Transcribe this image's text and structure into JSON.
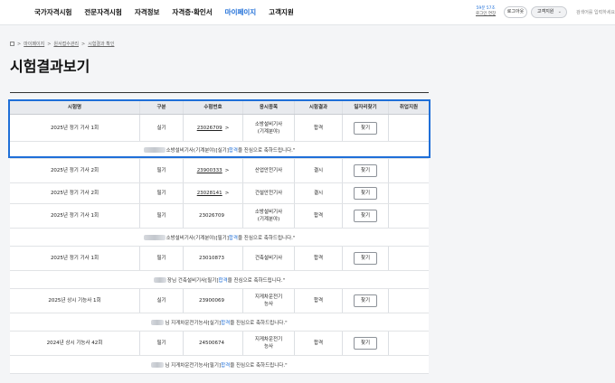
{
  "header": {
    "menu": [
      "국가자격시험",
      "전문자격시험",
      "자격정보",
      "자격증·확인서",
      "마이페이지",
      "고객지원"
    ],
    "active_index": 4,
    "remaining_time": "59분 57초",
    "extend_label": "로그인 연장",
    "logout_label": "로그아웃",
    "cs_label": "고객지원",
    "search_placeholder": "검색어를 입력하세요"
  },
  "breadcrumb": [
    "마이페이지",
    "원서접수관리",
    "시험결과 확인"
  ],
  "page_title": "시험결과보기",
  "table": {
    "headers": [
      "시험명",
      "구분",
      "수험번호",
      "응시종목",
      "시험결과",
      "일자리찾기",
      "취업지원"
    ],
    "rows": [
      {
        "exam": "2025년 정기 기사 1회",
        "type": "실기",
        "number": "23026709",
        "arrow": ">",
        "subject": [
          "소방설비기사",
          "(기계분야)"
        ],
        "result": "합격",
        "find": "찾기",
        "linked": true,
        "message": {
          "pre": "소방설비기사(기계분야)[실기] ",
          "pass": "합격",
          "post": "을 진심으로 축하드립니다.\""
        }
      },
      {
        "exam": "2025년 정기 기사 2회",
        "type": "필기",
        "number": "23900333",
        "arrow": ">",
        "subject": [
          "산업안전기사"
        ],
        "result": "결시",
        "find": "찾기",
        "linked": true
      },
      {
        "exam": "2025년 정기 기사 2회",
        "type": "필기",
        "number": "23028141",
        "arrow": ">",
        "subject": [
          "건설안전기사"
        ],
        "result": "결시",
        "find": "찾기",
        "linked": true
      },
      {
        "exam": "2025년 정기 기사 1회",
        "type": "필기",
        "number": "23026709",
        "arrow": "",
        "subject": [
          "소방설비기사",
          "(기계분야)"
        ],
        "result": "합격",
        "find": "찾기",
        "linked": false,
        "message": {
          "pre": "소방설비기사(기계분야)[필기] ",
          "pass": "합격",
          "post": "을 진심으로 축하드립니다.\""
        }
      },
      {
        "exam": "2025년 정기 기사 1회",
        "type": "필기",
        "number": "23010873",
        "arrow": "",
        "subject": [
          "건축설비기사"
        ],
        "result": "합격",
        "find": "찾기",
        "linked": false,
        "message": {
          "pre": "장님 건축설비기사[필기] ",
          "pass": "합격",
          "post": "을 진심으로 축하드립니다.\""
        }
      },
      {
        "exam": "2025년 상시 기능사 1회",
        "type": "실기",
        "number": "23900069",
        "arrow": "",
        "subject": [
          "지게차운전기",
          "능사"
        ],
        "result": "합격",
        "find": "찾기",
        "linked": false,
        "message": {
          "pre": "님 지게차운전기능사[실기] ",
          "pass": "합격",
          "post": "을 진심으로 축하드립니다.\""
        }
      },
      {
        "exam": "2024년 상시 기능사 42회",
        "type": "필기",
        "number": "24500674",
        "arrow": "",
        "subject": [
          "지게차운전기",
          "능사"
        ],
        "result": "합격",
        "find": "찾기",
        "linked": false,
        "message": {
          "pre": "님 지게차운전기능사[필기] ",
          "pass": "합격",
          "post": "을 진심으로 축하드립니다.\""
        }
      }
    ]
  },
  "colors": {
    "accent": "#1f6fd8"
  }
}
